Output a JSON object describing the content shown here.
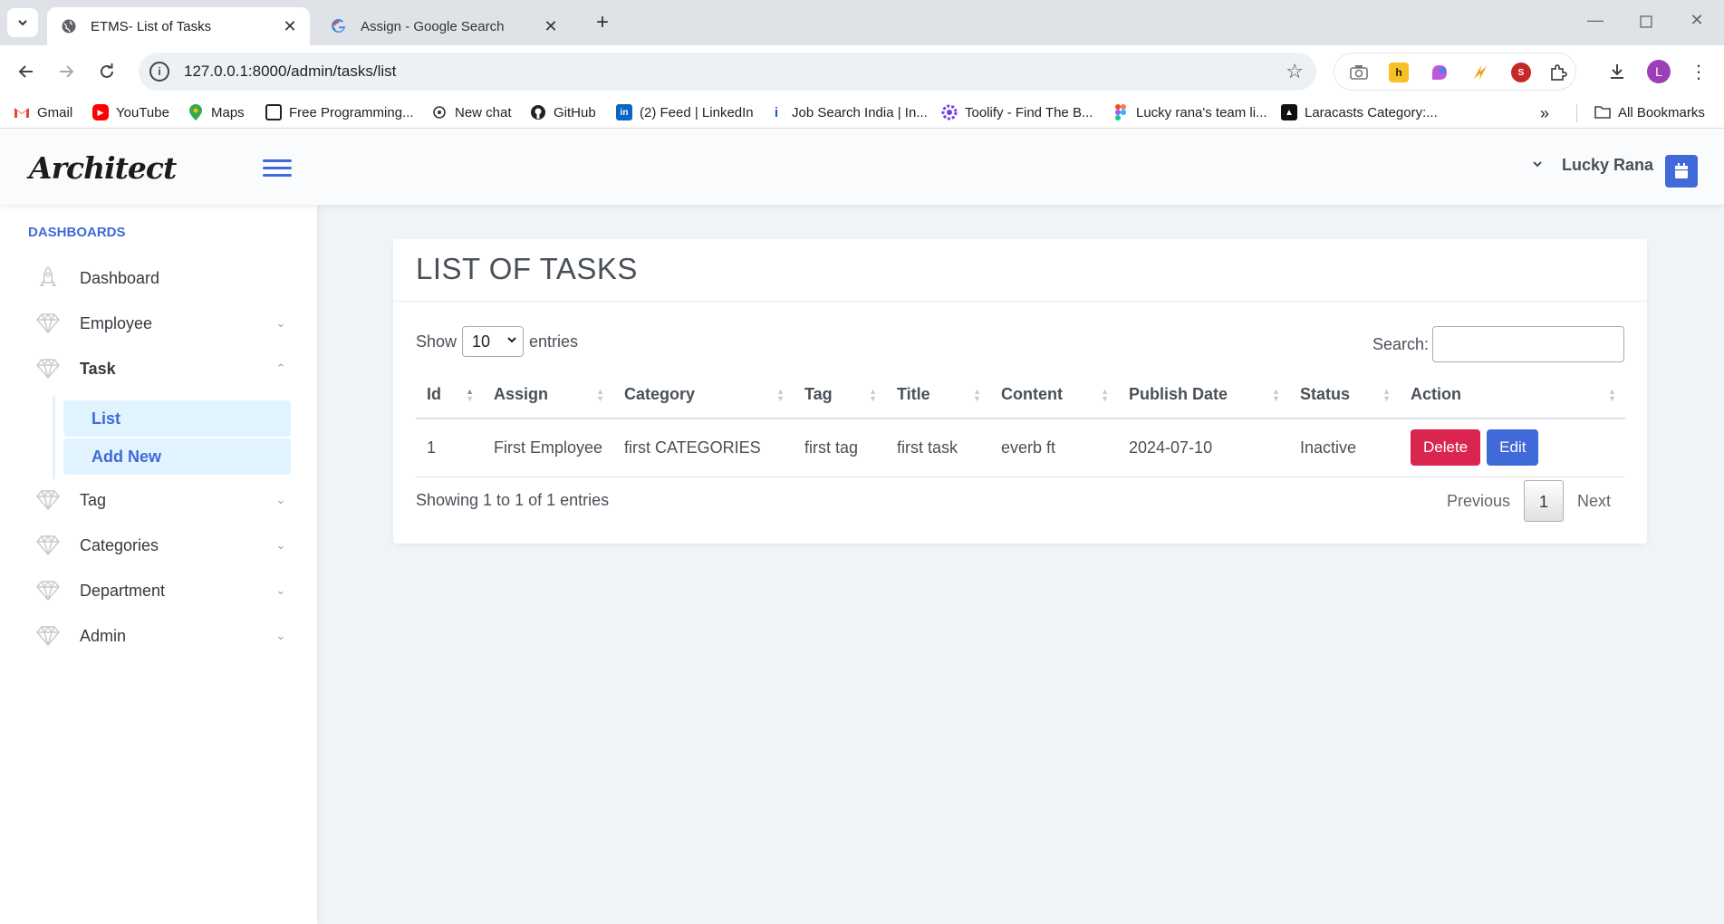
{
  "browser": {
    "tabs": [
      {
        "title": "ETMS- List of Tasks",
        "icon": "globe-icon",
        "active": true
      },
      {
        "title": "Assign - Google Search",
        "icon": "google-icon",
        "active": false
      }
    ],
    "url": "127.0.0.1:8000/admin/tasks/list",
    "profile_initial": "L",
    "bookmarks": [
      {
        "label": "Gmail",
        "icon": "gmail-icon"
      },
      {
        "label": "YouTube",
        "icon": "youtube-icon"
      },
      {
        "label": "Maps",
        "icon": "maps-icon"
      },
      {
        "label": "Free Programming...",
        "icon": "bookmark-page-icon"
      },
      {
        "label": "New chat",
        "icon": "openai-icon"
      },
      {
        "label": "GitHub",
        "icon": "github-icon"
      },
      {
        "label": "(2) Feed | LinkedIn",
        "icon": "linkedin-icon"
      },
      {
        "label": "Job Search India | In...",
        "icon": "indeed-icon"
      },
      {
        "label": "Toolify - Find The B...",
        "icon": "toolify-icon"
      },
      {
        "label": "Lucky rana's team li...",
        "icon": "figma-icon"
      },
      {
        "label": "Laracasts Category:...",
        "icon": "laracasts-icon"
      }
    ],
    "all_bookmarks": "All Bookmarks"
  },
  "app": {
    "logo": "Architect",
    "user_name": "Lucky Rana"
  },
  "sidebar": {
    "heading": "DASHBOARDS",
    "items": [
      {
        "label": "Dashboard",
        "icon": "rocket-icon",
        "has_chevron": false
      },
      {
        "label": "Employee",
        "icon": "diamond-icon",
        "has_chevron": true
      },
      {
        "label": "Task",
        "icon": "diamond-icon",
        "has_chevron": true,
        "expanded": true
      },
      {
        "label": "Tag",
        "icon": "diamond-icon",
        "has_chevron": true
      },
      {
        "label": "Categories",
        "icon": "diamond-icon",
        "has_chevron": true
      },
      {
        "label": "Department",
        "icon": "diamond-icon",
        "has_chevron": true
      },
      {
        "label": "Admin",
        "icon": "diamond-icon",
        "has_chevron": true
      }
    ],
    "task_sub": [
      {
        "label": "List"
      },
      {
        "label": "Add New"
      }
    ]
  },
  "page": {
    "title": "LIST OF TASKS",
    "show_label": "Show",
    "entries_label": "entries",
    "page_size": "10",
    "search_label": "Search:",
    "search_value": ""
  },
  "table": {
    "columns": [
      "Id",
      "Assign",
      "Category",
      "Tag",
      "Title",
      "Content",
      "Publish Date",
      "Status",
      "Action"
    ],
    "rows": [
      {
        "id": "1",
        "assign": "First Employee",
        "category": "first CATEGORIES",
        "tag": "first tag",
        "title": "first task",
        "content": "everb ft",
        "publish_date": "2024-07-10",
        "status": "Inactive",
        "delete_label": "Delete",
        "edit_label": "Edit"
      }
    ]
  },
  "footer": {
    "info": "Showing 1 to 1 of 1 entries",
    "previous": "Previous",
    "current_page": "1",
    "next": "Next"
  },
  "colors": {
    "primary": "#3f6ad8",
    "danger": "#d92550",
    "active_sub_bg": "#e0f3ff"
  }
}
